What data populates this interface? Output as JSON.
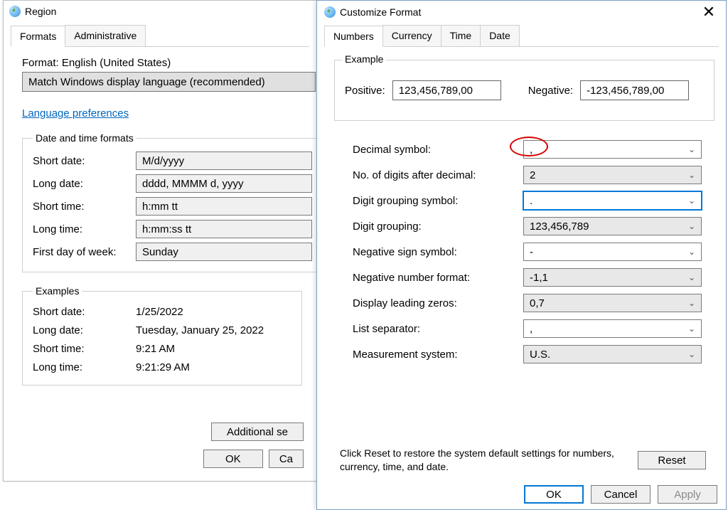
{
  "region": {
    "title": "Region",
    "tabs": {
      "formats": "Formats",
      "admin": "Administrative"
    },
    "format_label": "Format: English (United States)",
    "format_combo": "Match Windows display language (recommended)",
    "language_prefs_link": "Language preferences",
    "date_time_group": "Date and time formats",
    "short_date_lbl": "Short date:",
    "short_date_val": "M/d/yyyy",
    "long_date_lbl": "Long date:",
    "long_date_val": "dddd, MMMM d, yyyy",
    "short_time_lbl": "Short time:",
    "short_time_val": "h:mm tt",
    "long_time_lbl": "Long time:",
    "long_time_val": "h:mm:ss tt",
    "first_day_lbl": "First day of week:",
    "first_day_val": "Sunday",
    "examples_group": "Examples",
    "ex_short_date_lbl": "Short date:",
    "ex_short_date_val": "1/25/2022",
    "ex_long_date_lbl": "Long date:",
    "ex_long_date_val": "Tuesday, January 25, 2022",
    "ex_short_time_lbl": "Short time:",
    "ex_short_time_val": "9:21 AM",
    "ex_long_time_lbl": "Long time:",
    "ex_long_time_val": "9:21:29 AM",
    "additional_btn": "Additional se",
    "ok_btn": "OK",
    "cancel_btn": "Ca"
  },
  "customize": {
    "title": "Customize Format",
    "tabs": {
      "numbers": "Numbers",
      "currency": "Currency",
      "time": "Time",
      "date": "Date"
    },
    "example_legend": "Example",
    "positive_lbl": "Positive:",
    "positive_val": "123,456,789,00",
    "negative_lbl": "Negative:",
    "negative_val": "-123,456,789,00",
    "rows": {
      "decimal_symbol_lbl": "Decimal symbol:",
      "decimal_symbol_val": ",",
      "digits_after_lbl": "No. of digits after decimal:",
      "digits_after_val": "2",
      "grouping_symbol_lbl": "Digit grouping symbol:",
      "grouping_symbol_val": ".",
      "grouping_lbl": "Digit grouping:",
      "grouping_val": "123,456,789",
      "neg_sign_lbl": "Negative sign symbol:",
      "neg_sign_val": "-",
      "neg_fmt_lbl": "Negative number format:",
      "neg_fmt_val": "-1,1",
      "leading_zero_lbl": "Display leading zeros:",
      "leading_zero_val": "0,7",
      "list_sep_lbl": "List separator:",
      "list_sep_val": ",",
      "measure_lbl": "Measurement system:",
      "measure_val": "U.S."
    },
    "reset_text": "Click Reset to restore the system default settings for numbers, currency, time, and date.",
    "reset_btn": "Reset",
    "ok_btn": "OK",
    "cancel_btn": "Cancel",
    "apply_btn": "Apply"
  }
}
